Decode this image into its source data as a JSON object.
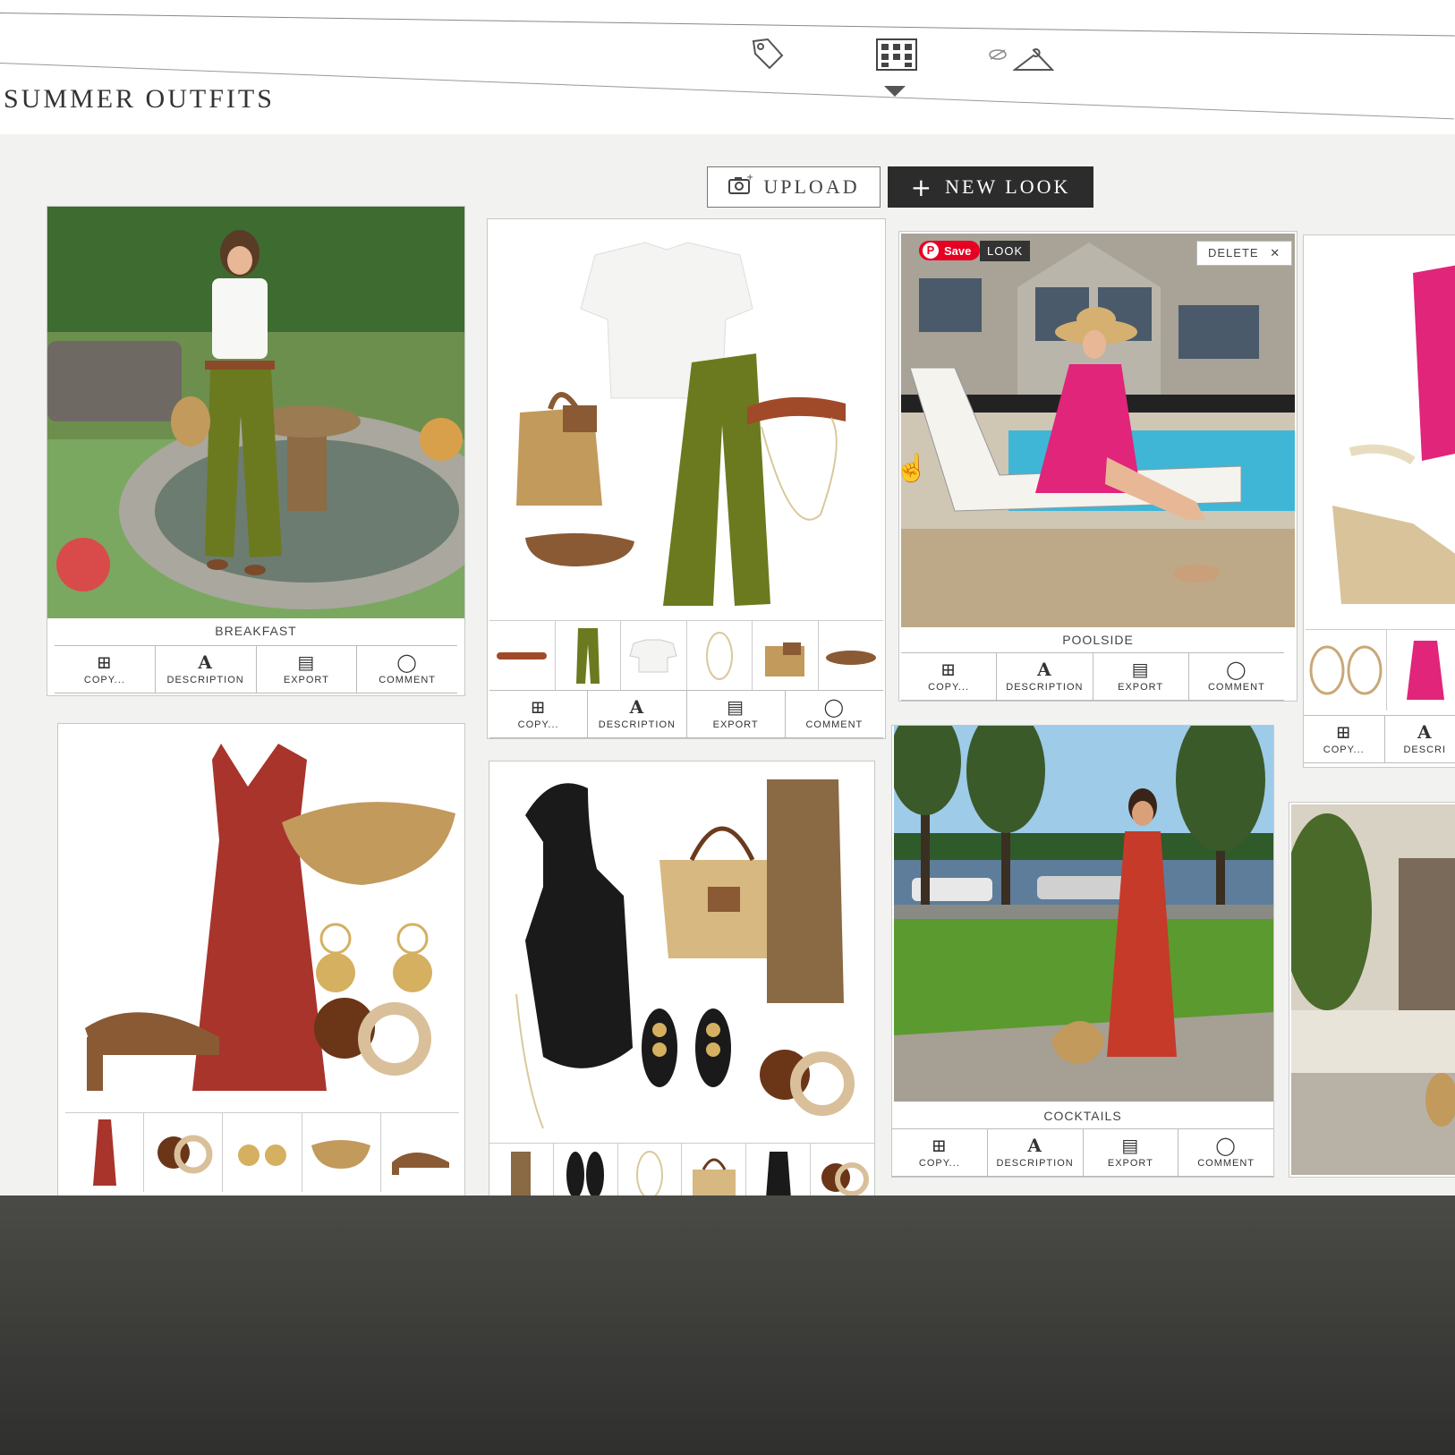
{
  "page": {
    "title": "SUMMER OUTFITS"
  },
  "nav": {
    "icons": [
      "tag-icon",
      "lookbook-icon",
      "hanger-icon"
    ]
  },
  "toolbar": {
    "upload_label": "UPLOAD",
    "new_look_label": "NEW LOOK"
  },
  "actions": {
    "copy": "COPY...",
    "description": "DESCRIPTION",
    "export": "EXPORT",
    "comment": "COMMENT"
  },
  "cards": {
    "breakfast": {
      "title": "BREAKFAST"
    },
    "poolside": {
      "title": "POOLSIDE",
      "save_label": "Save",
      "look_label": "LOOK",
      "delete_label": "DELETE"
    },
    "cocktails": {
      "title": "COCKTAILS"
    }
  },
  "partial": {
    "copy": "COPY...",
    "description": "DESCRI"
  },
  "colors": {
    "olive": "#6b7a1e",
    "rust": "#a8342c",
    "straw": "#c29a5c",
    "tan": "#8a5a34",
    "pink": "#e0257a",
    "black": "#1a1a1a",
    "pool": "#3fb6d6",
    "grass": "#5b9a2e",
    "sky": "#9ecbe8",
    "pinterest": "#e60023"
  }
}
